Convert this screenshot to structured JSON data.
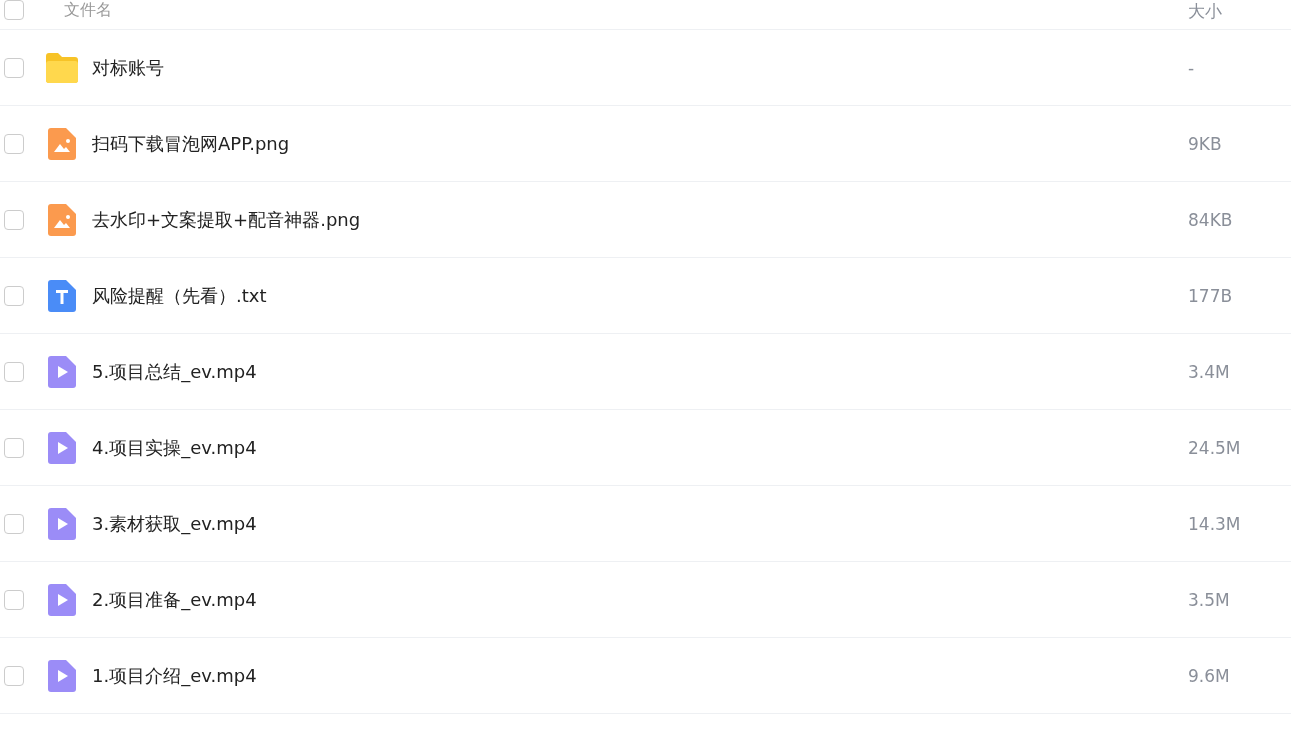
{
  "header": {
    "checked": false,
    "columns": [
      "文件名",
      "大小"
    ]
  },
  "rows": [
    {
      "kind": "folder",
      "name": "对标账号",
      "size": "-",
      "checked": false
    },
    {
      "kind": "image",
      "name": "扫码下载冒泡网APP.png",
      "size": "9KB",
      "checked": false
    },
    {
      "kind": "image",
      "name": "去水印+文案提取+配音神器.png",
      "size": "84KB",
      "checked": false
    },
    {
      "kind": "text",
      "name": "风险提醒（先看）.txt",
      "size": "177B",
      "checked": false
    },
    {
      "kind": "video",
      "name": "5.项目总结_ev.mp4",
      "size": "3.4M",
      "checked": false
    },
    {
      "kind": "video",
      "name": "4.项目实操_ev.mp4",
      "size": "24.5M",
      "checked": false
    },
    {
      "kind": "video",
      "name": "3.素材获取_ev.mp4",
      "size": "14.3M",
      "checked": false
    },
    {
      "kind": "video",
      "name": "2.项目准备_ev.mp4",
      "size": "3.5M",
      "checked": false
    },
    {
      "kind": "video",
      "name": "1.项目介绍_ev.mp4",
      "size": "9.6M",
      "checked": false
    }
  ]
}
